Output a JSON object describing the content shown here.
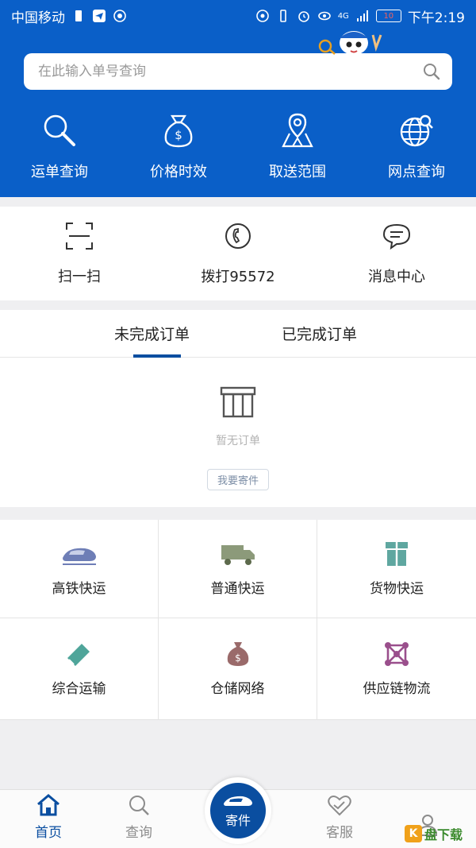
{
  "status_bar": {
    "carrier": "中国移动",
    "network": "4G",
    "battery": "10",
    "time": "下午2:19"
  },
  "search": {
    "placeholder": "在此输入单号查询"
  },
  "quick_actions": [
    {
      "label": "运单查询",
      "icon": "search-icon"
    },
    {
      "label": "价格时效",
      "icon": "money-bag-icon"
    },
    {
      "label": "取送范围",
      "icon": "map-pin-icon"
    },
    {
      "label": "网点查询",
      "icon": "globe-search-icon"
    }
  ],
  "secondary_actions": [
    {
      "label": "扫一扫",
      "icon": "scan-icon"
    },
    {
      "label": "拨打95572",
      "icon": "phone-icon"
    },
    {
      "label": "消息中心",
      "icon": "chat-icon"
    }
  ],
  "orders": {
    "tabs": [
      {
        "label": "未完成订单",
        "active": true
      },
      {
        "label": "已完成订单",
        "active": false
      }
    ],
    "empty_text": "暂无订单",
    "send_button": "我要寄件"
  },
  "services": [
    {
      "label": "高铁快运",
      "icon": "high-speed-train-icon"
    },
    {
      "label": "普通快运",
      "icon": "truck-icon"
    },
    {
      "label": "货物快运",
      "icon": "parcel-icon"
    },
    {
      "label": "综合运输",
      "icon": "ticket-icon"
    },
    {
      "label": "仓储网络",
      "icon": "money-bag-icon"
    },
    {
      "label": "供应链物流",
      "icon": "network-icon"
    }
  ],
  "bottom_nav": {
    "home": "首页",
    "query": "查询",
    "send": "寄件",
    "service": "客服",
    "profile": ""
  },
  "watermark": {
    "text": "盘下载"
  },
  "colors": {
    "primary": "#0a5fc8",
    "dark_blue": "#0a4ea0",
    "train_icon": "#6e7eb6",
    "truck_icon": "#8c9a7a",
    "parcel_icon": "#5fa7a0",
    "ticket_icon": "#4fa59a",
    "money_icon": "#9a6a6a",
    "network_icon": "#9a4f8c"
  }
}
